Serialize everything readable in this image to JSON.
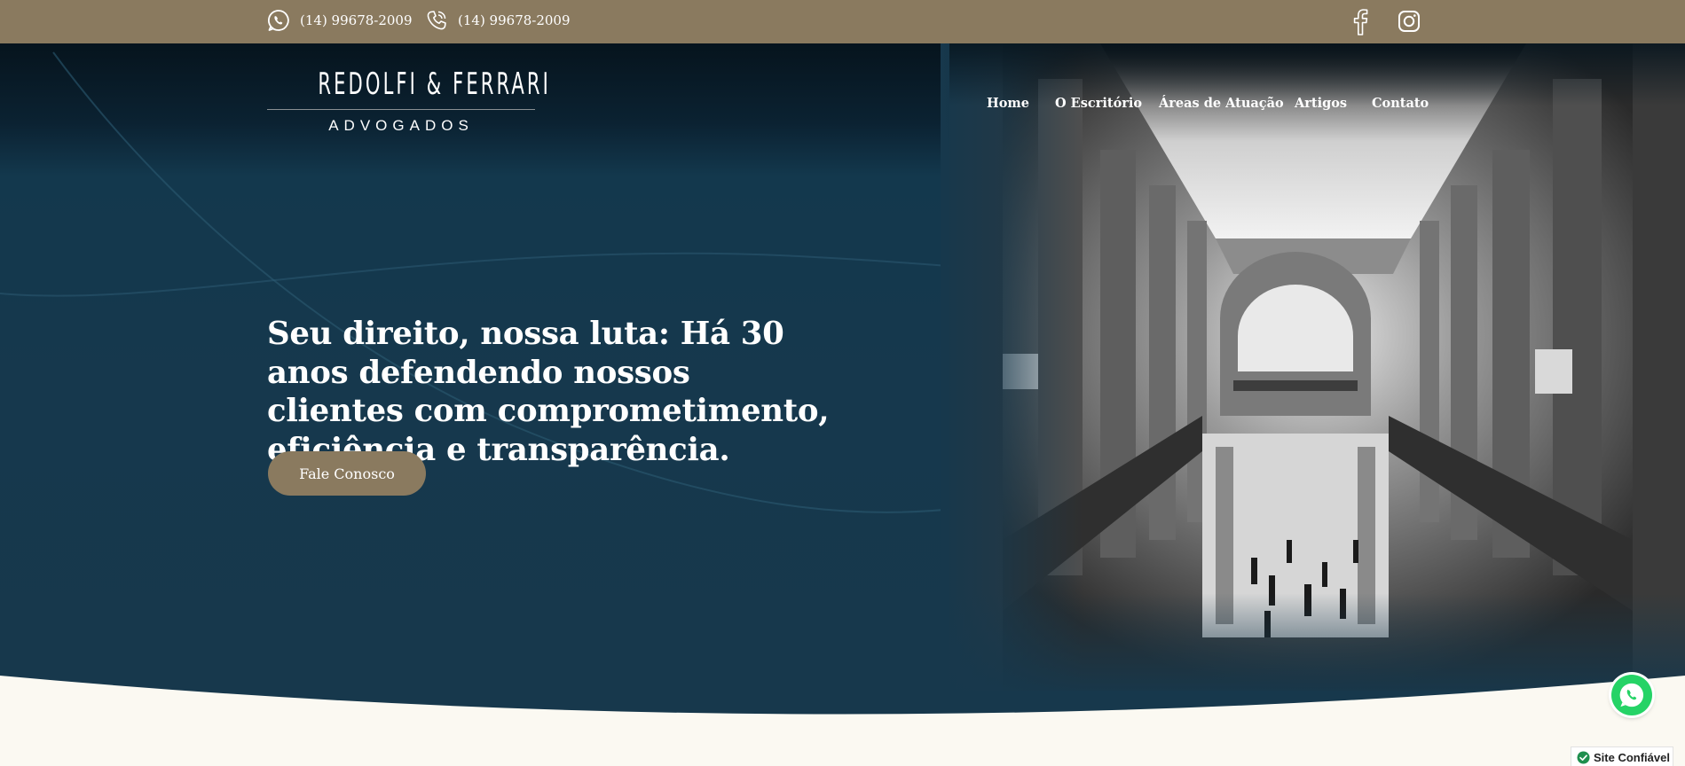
{
  "topbar": {
    "contacts": [
      {
        "icon": "whatsapp-icon",
        "text": "(14) 99678-2009"
      },
      {
        "icon": "phone-icon",
        "text": "(14) 99678-2009"
      }
    ],
    "social": [
      "facebook-icon",
      "instagram-icon"
    ],
    "background": "#8a7a5f"
  },
  "logo": {
    "main": "REDOLFI & FERRARI",
    "sub": "ADVOGADOS"
  },
  "nav": {
    "items": [
      {
        "label": "Home"
      },
      {
        "label": "O Escritório"
      },
      {
        "label": "Áreas de Atuação"
      },
      {
        "label": "Artigos"
      },
      {
        "label": "Contato"
      }
    ]
  },
  "hero": {
    "headline": "Seu direito, nossa luta: Há 30 anos defendendo nossos clientes com comprometimento, eficiência e transparência.",
    "cta": "Fale Conosco",
    "background": "#17384c",
    "accent": "#8a7a5f"
  },
  "floating": {
    "whatsapp": "whatsapp-icon",
    "badge": "Site Confiável",
    "badge_icon": "check-icon"
  }
}
